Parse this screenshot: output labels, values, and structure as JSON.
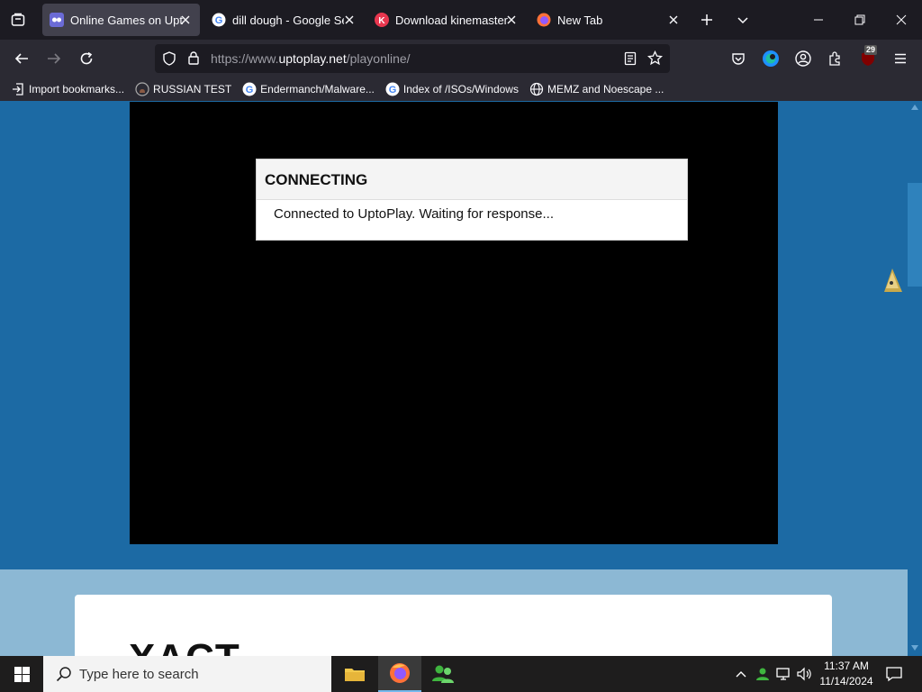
{
  "browser": {
    "tabs": [
      {
        "title": "Online Games on Uptoplay",
        "active": true,
        "icon": "uptoplay-icon"
      },
      {
        "title": "dill dough - Google Search",
        "active": false,
        "icon": "google-icon"
      },
      {
        "title": "Download kinemaster",
        "active": false,
        "icon": "kinemaster-icon"
      },
      {
        "title": "New Tab",
        "active": false,
        "icon": "firefox-icon"
      }
    ],
    "url": {
      "prefix": "https://www.",
      "host": "uptoplay.net",
      "path": "/playonline/"
    },
    "extension_badge": "29",
    "bookmarks": [
      {
        "label": "Import bookmarks...",
        "icon": "import-icon"
      },
      {
        "label": "RUSSIAN TEST",
        "icon": "github-icon"
      },
      {
        "label": "Endermanch/Malware...",
        "icon": "google-icon"
      },
      {
        "label": "Index of /ISOs/Windows",
        "icon": "google-icon"
      },
      {
        "label": "MEMZ and Noescape ...",
        "icon": "globe-icon"
      }
    ]
  },
  "page": {
    "dialog": {
      "title": "CONNECTING",
      "message": "Connected to UptoPlay. Waiting for response..."
    },
    "card_title": "XACT"
  },
  "taskbar": {
    "search_placeholder": "Type here to search",
    "time": "11:37 AM",
    "date": "11/14/2024"
  },
  "colors": {
    "page_bg": "#1c6aa4",
    "tab_active": "#42414d",
    "toolbar": "#2b2a33"
  }
}
